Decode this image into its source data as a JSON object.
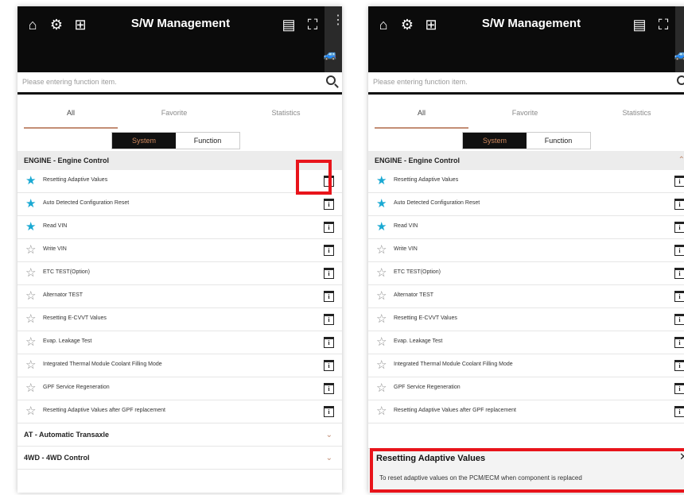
{
  "header": {
    "title": "S/W Management"
  },
  "search": {
    "placeholder": "Please entering function item."
  },
  "tabs": [
    "All",
    "Favorite",
    "Statistics"
  ],
  "segment": {
    "system": "System",
    "function": "Function"
  },
  "sections": [
    {
      "label": "ENGINE - Engine Control",
      "expanded": true
    },
    {
      "label": "AT - Automatic Transaxle",
      "expanded": false
    },
    {
      "label": "4WD - 4WD Control",
      "expanded": false
    }
  ],
  "items": [
    {
      "label": "Resetting Adaptive Values",
      "favorite": true
    },
    {
      "label": "Auto Detected Configuration Reset",
      "favorite": true
    },
    {
      "label": "Read VIN",
      "favorite": true
    },
    {
      "label": "Write VIN",
      "favorite": false
    },
    {
      "label": "ETC TEST(Option)",
      "favorite": false
    },
    {
      "label": "Alternator TEST",
      "favorite": false
    },
    {
      "label": "Resetting E-CVVT Values",
      "favorite": false
    },
    {
      "label": "Evap. Leakage Test",
      "favorite": false
    },
    {
      "label": "Integrated Thermal Module Coolant Filling Mode",
      "favorite": false
    },
    {
      "label": "GPF Service Regeneration",
      "favorite": false
    },
    {
      "label": "Resetting Adaptive Values after GPF replacement",
      "favorite": false
    }
  ],
  "popup": {
    "title": "Resetting Adaptive Values",
    "description": "To reset adaptive values on the PCM/ECM when component is replaced"
  },
  "colors": {
    "accent": "#c38e75",
    "favorite": "#1aa9d3",
    "highlight": "#e8141b",
    "header": "#0b0b0b"
  },
  "icons": [
    "home-icon",
    "settings-icon",
    "add-screen-icon",
    "dtc-icon",
    "fullscreen-icon",
    "more-vertical-icon",
    "vehicle-icon",
    "search-icon",
    "star-icon",
    "info-icon",
    "chevron-up-icon",
    "chevron-down-icon",
    "close-icon"
  ]
}
